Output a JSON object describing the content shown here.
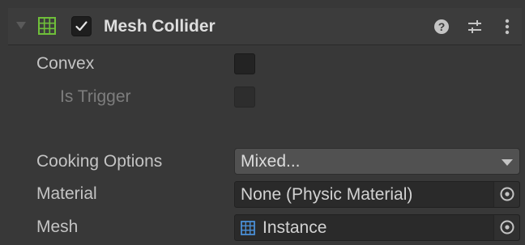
{
  "component": {
    "title": "Mesh Collider",
    "enabled": true,
    "icons": {
      "foldout": "foldout-arrow-icon",
      "component": "mesh-grid-icon",
      "help": "help-icon",
      "presets": "presets-icon",
      "menu": "kebab-menu-icon"
    }
  },
  "properties": {
    "convex": {
      "label": "Convex",
      "checked": false
    },
    "is_trigger": {
      "label": "Is Trigger",
      "checked": false,
      "disabled": true
    },
    "cooking_options": {
      "label": "Cooking Options",
      "value": "Mixed..."
    },
    "material": {
      "label": "Material",
      "value": "None (Physic Material)"
    },
    "mesh": {
      "label": "Mesh",
      "value": "Instance"
    }
  },
  "colors": {
    "background": "#383838",
    "mesh_icon_green": "#6fbf3a",
    "mesh_icon_blue": "#4a8fd6"
  }
}
